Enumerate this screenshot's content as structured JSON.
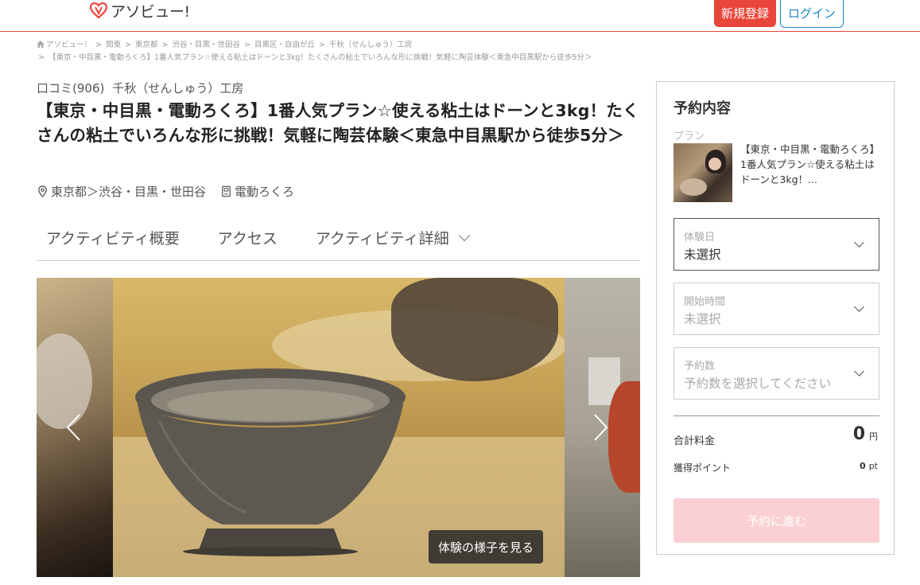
{
  "header": {
    "logo_text": "アソビュー!",
    "register_label": "新規登録",
    "login_label": "ログイン"
  },
  "breadcrumb": {
    "items": [
      "アソビュー！",
      "関東",
      "東京都",
      "渋谷・目黒・世田谷",
      "目黒区・自由が丘",
      "千秋（せんしゅう）工房"
    ],
    "current": "【東京・中目黒・電動ろくろ】1番人気プラン☆使える粘土はドーンと3kg！たくさんの粘土でいろんな形に挑戦！気軽に陶芸体験＜東急中目黒駅から徒歩5分＞"
  },
  "activity": {
    "reviews": "口コミ(906)",
    "shop_name": "千秋（せんしゅう）工房",
    "title": "【東京・中目黒・電動ろくろ】1番人気プラン☆使える粘土はドーンと3kg！たくさんの粘土でいろんな形に挑戦！気軽に陶芸体験＜東急中目黒駅から徒歩5分＞",
    "location": "東京都＞渋谷・目黒・世田谷",
    "category": "電動ろくろ"
  },
  "tabs": [
    {
      "label": "アクティビティ概要"
    },
    {
      "label": "アクセス"
    },
    {
      "label": "アクティビティ詳細"
    }
  ],
  "carousel": {
    "caption_button": "体験の様子を見る"
  },
  "reservation": {
    "title": "予約内容",
    "plan_label": "プラン",
    "plan_name": "【東京・中目黒・電動ろくろ】1番人気プラン☆使える粘土はドーンと3kg！...",
    "date": {
      "label": "体験日",
      "value": "未選択"
    },
    "time": {
      "label": "開始時間",
      "value": "未選択"
    },
    "count": {
      "label": "予約数",
      "value": "予約数を選択してください"
    },
    "total_label": "合計料金",
    "total_value": "0",
    "total_unit": "円",
    "points_label": "獲得ポイント",
    "points_value": "0",
    "points_unit": "pt",
    "submit_label": "予約に進む"
  },
  "colors": {
    "brand_red": "#e8463a",
    "login_blue": "#1e88c8",
    "submit_disabled": "#fbd0d4"
  }
}
